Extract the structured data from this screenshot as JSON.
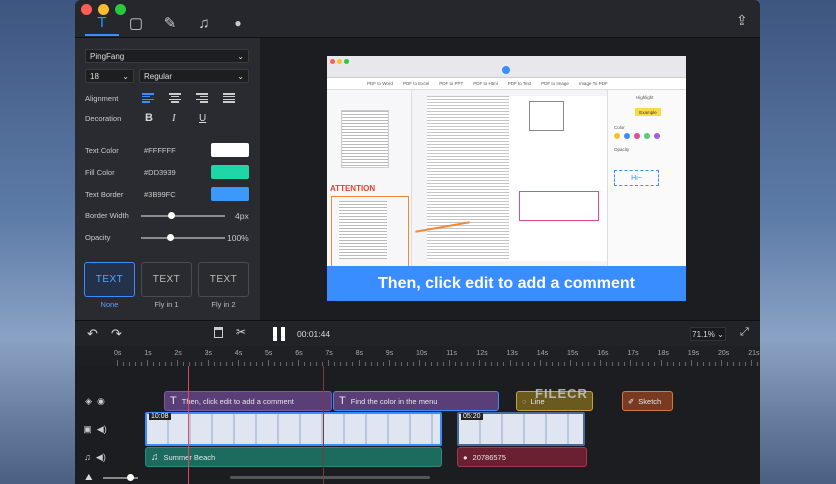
{
  "colors": {
    "accent": "#3a8dff",
    "close": "#ff5f57",
    "minimize": "#febc2e",
    "maximize": "#28c840"
  },
  "toolbar": {
    "tabs": [
      {
        "name": "text-tab",
        "icon": "T"
      },
      {
        "name": "shape-tab",
        "icon": "▢"
      },
      {
        "name": "pen-tab",
        "icon": "✎"
      },
      {
        "name": "music-tab",
        "icon": "♫"
      },
      {
        "name": "mic-tab",
        "icon": "🎙"
      }
    ],
    "export_icon": "⇪"
  },
  "panel": {
    "font": "PingFang",
    "size": "18",
    "weight": "Regular",
    "alignment_label": "Alignment",
    "decoration_label": "Decoration",
    "bold": "B",
    "italic": "I",
    "underline": "U",
    "text_color_label": "Text Color",
    "text_color": "#FFFFFF",
    "fill_color_label": "Fill Color",
    "fill_color": "#DD3939",
    "text_border_label": "Text Border",
    "text_border": "#3B99FC",
    "border_width_label": "Border Width",
    "border_width": "4px",
    "border_width_value": 0.4,
    "opacity_label": "Opacity",
    "opacity": "100%",
    "opacity_value": 1.0,
    "anims": [
      {
        "label": "TEXT",
        "name": "None"
      },
      {
        "label": "TEXT",
        "name": "Fly in 1"
      },
      {
        "label": "TEXT",
        "name": "Fly in 2"
      }
    ]
  },
  "preview": {
    "caption": "Then, click edit to add a comment",
    "attention": "ATTENTION",
    "toolbar_items": [
      "PDF to Word",
      "PDF to Excel",
      "PDF to PPT",
      "PDF to Html",
      "PDF to Text",
      "PDF to Image",
      "Image To PDF"
    ],
    "highlight": "Highlight",
    "example": "Example",
    "color": "Color",
    "opacity": "Opacity"
  },
  "controls": {
    "undo": "↶",
    "redo": "↷",
    "delete": "🗑",
    "cut": "✂",
    "time": "00:01:44",
    "zoom": "71.1%"
  },
  "ruler": [
    "0s",
    "1s",
    "2s",
    "3s",
    "4s",
    "5s",
    "6s",
    "7s",
    "8s",
    "9s",
    "10s",
    "11s",
    "12s",
    "13s",
    "14s",
    "15s",
    "16s",
    "17s",
    "18s",
    "19s",
    "20s",
    "21s"
  ],
  "timeline": {
    "text_clips": [
      "Then, click edit to add a comment",
      "Find the color in the menu"
    ],
    "shape_clips": [
      "Line",
      "Sketch"
    ],
    "video_durations": [
      "10:08",
      "05:20"
    ],
    "audio_clips": [
      "Summer Beach",
      "20786575"
    ],
    "watermark": "FILECR"
  }
}
